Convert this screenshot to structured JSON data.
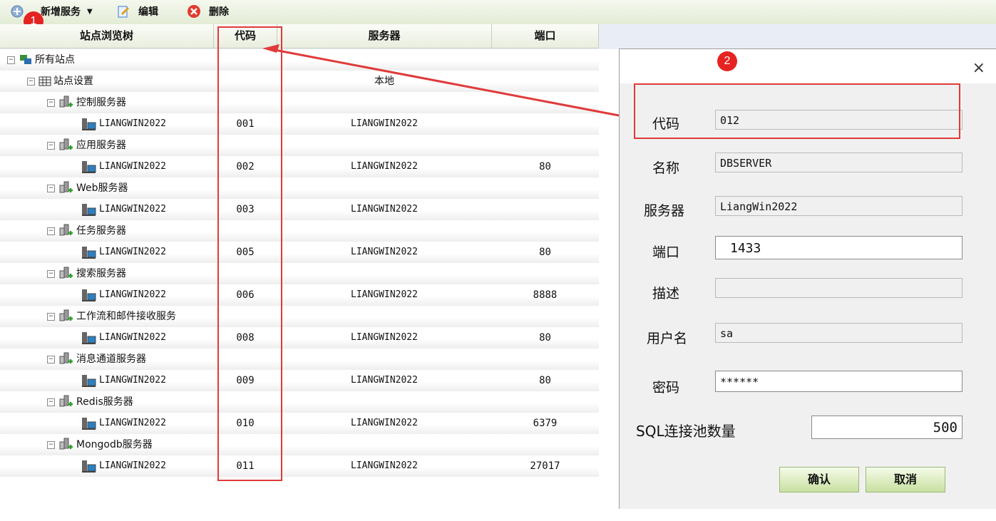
{
  "toolbar": {
    "add_service": "新增服务",
    "edit": "编辑",
    "delete": "删除",
    "badge1": "1"
  },
  "grid": {
    "headers": [
      "站点浏览树",
      "代码",
      "服务器",
      "端口"
    ],
    "root": "所有站点",
    "settings": "站点设置",
    "settings_server": "本地",
    "groups": [
      {
        "name": "控制服务器",
        "host": "LIANGWIN2022",
        "code": "001",
        "server": "LIANGWIN2022",
        "port": ""
      },
      {
        "name": "应用服务器",
        "host": "LIANGWIN2022",
        "code": "002",
        "server": "LIANGWIN2022",
        "port": "80"
      },
      {
        "name": "Web服务器",
        "host": "LIANGWIN2022",
        "code": "003",
        "server": "LIANGWIN2022",
        "port": ""
      },
      {
        "name": "任务服务器",
        "host": "LIANGWIN2022",
        "code": "005",
        "server": "LIANGWIN2022",
        "port": "80"
      },
      {
        "name": "搜索服务器",
        "host": "LIANGWIN2022",
        "code": "006",
        "server": "LIANGWIN2022",
        "port": "8888"
      },
      {
        "name": "工作流和邮件接收服务",
        "host": "LIANGWIN2022",
        "code": "008",
        "server": "LIANGWIN2022",
        "port": "80"
      },
      {
        "name": "消息通道服务器",
        "host": "LIANGWIN2022",
        "code": "009",
        "server": "LIANGWIN2022",
        "port": "80"
      },
      {
        "name": "Redis服务器",
        "host": "LIANGWIN2022",
        "code": "010",
        "server": "LIANGWIN2022",
        "port": "6379"
      },
      {
        "name": "Mongodb服务器",
        "host": "LIANGWIN2022",
        "code": "011",
        "server": "LIANGWIN2022",
        "port": "27017"
      }
    ]
  },
  "dialog": {
    "badge2": "2",
    "close": "×",
    "fields": {
      "code_label": "代码",
      "code_value": "012",
      "name_label": "名称",
      "name_value": "DBSERVER",
      "server_label": "服务器",
      "server_value": "LiangWin2022",
      "port_label": "端口",
      "port_value": "1433",
      "desc_label": "描述",
      "desc_value": "",
      "user_label": "用户名",
      "user_value": "sa",
      "pwd_label": "密码",
      "pwd_value": "******",
      "pool_label": "SQL连接池数量",
      "pool_value": "500"
    },
    "ok": "确认",
    "cancel": "取消"
  },
  "colors": {
    "annotation": "#e03a3a",
    "button_green": "#c8e0a0"
  }
}
